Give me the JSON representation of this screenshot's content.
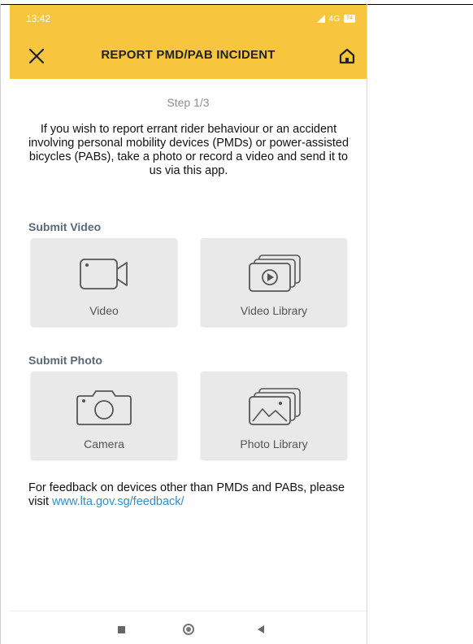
{
  "status_bar": {
    "time": "13:42",
    "network": "4G",
    "battery": "74"
  },
  "app_bar": {
    "title": "REPORT PMD/PAB INCIDENT",
    "close_icon": "close-icon",
    "home_icon": "home-icon",
    "background_color": "#f7c53e"
  },
  "step": {
    "label": "Step 1/3"
  },
  "intro": {
    "text": "If you wish to report errant rider behaviour or an accident involving personal mobility devices (PMDs) or power-assisted bicycles (PABs), take a photo or record a video and send it to us via this app."
  },
  "sections": {
    "video": {
      "title": "Submit Video",
      "options": [
        {
          "label": "Video",
          "icon": "video-camera-icon"
        },
        {
          "label": "Video Library",
          "icon": "video-library-icon"
        }
      ]
    },
    "photo": {
      "title": "Submit Photo",
      "options": [
        {
          "label": "Camera",
          "icon": "camera-icon"
        },
        {
          "label": "Photo Library",
          "icon": "photo-library-icon"
        }
      ]
    }
  },
  "feedback": {
    "text": "For feedback on devices other than PMDs and PABs, please visit ",
    "link_text": "www.lta.gov.sg/feedback/",
    "link_color": "#2e8fd1"
  },
  "navigation_bar": {
    "icons": [
      "recents-icon",
      "home-button-icon",
      "back-icon"
    ]
  }
}
